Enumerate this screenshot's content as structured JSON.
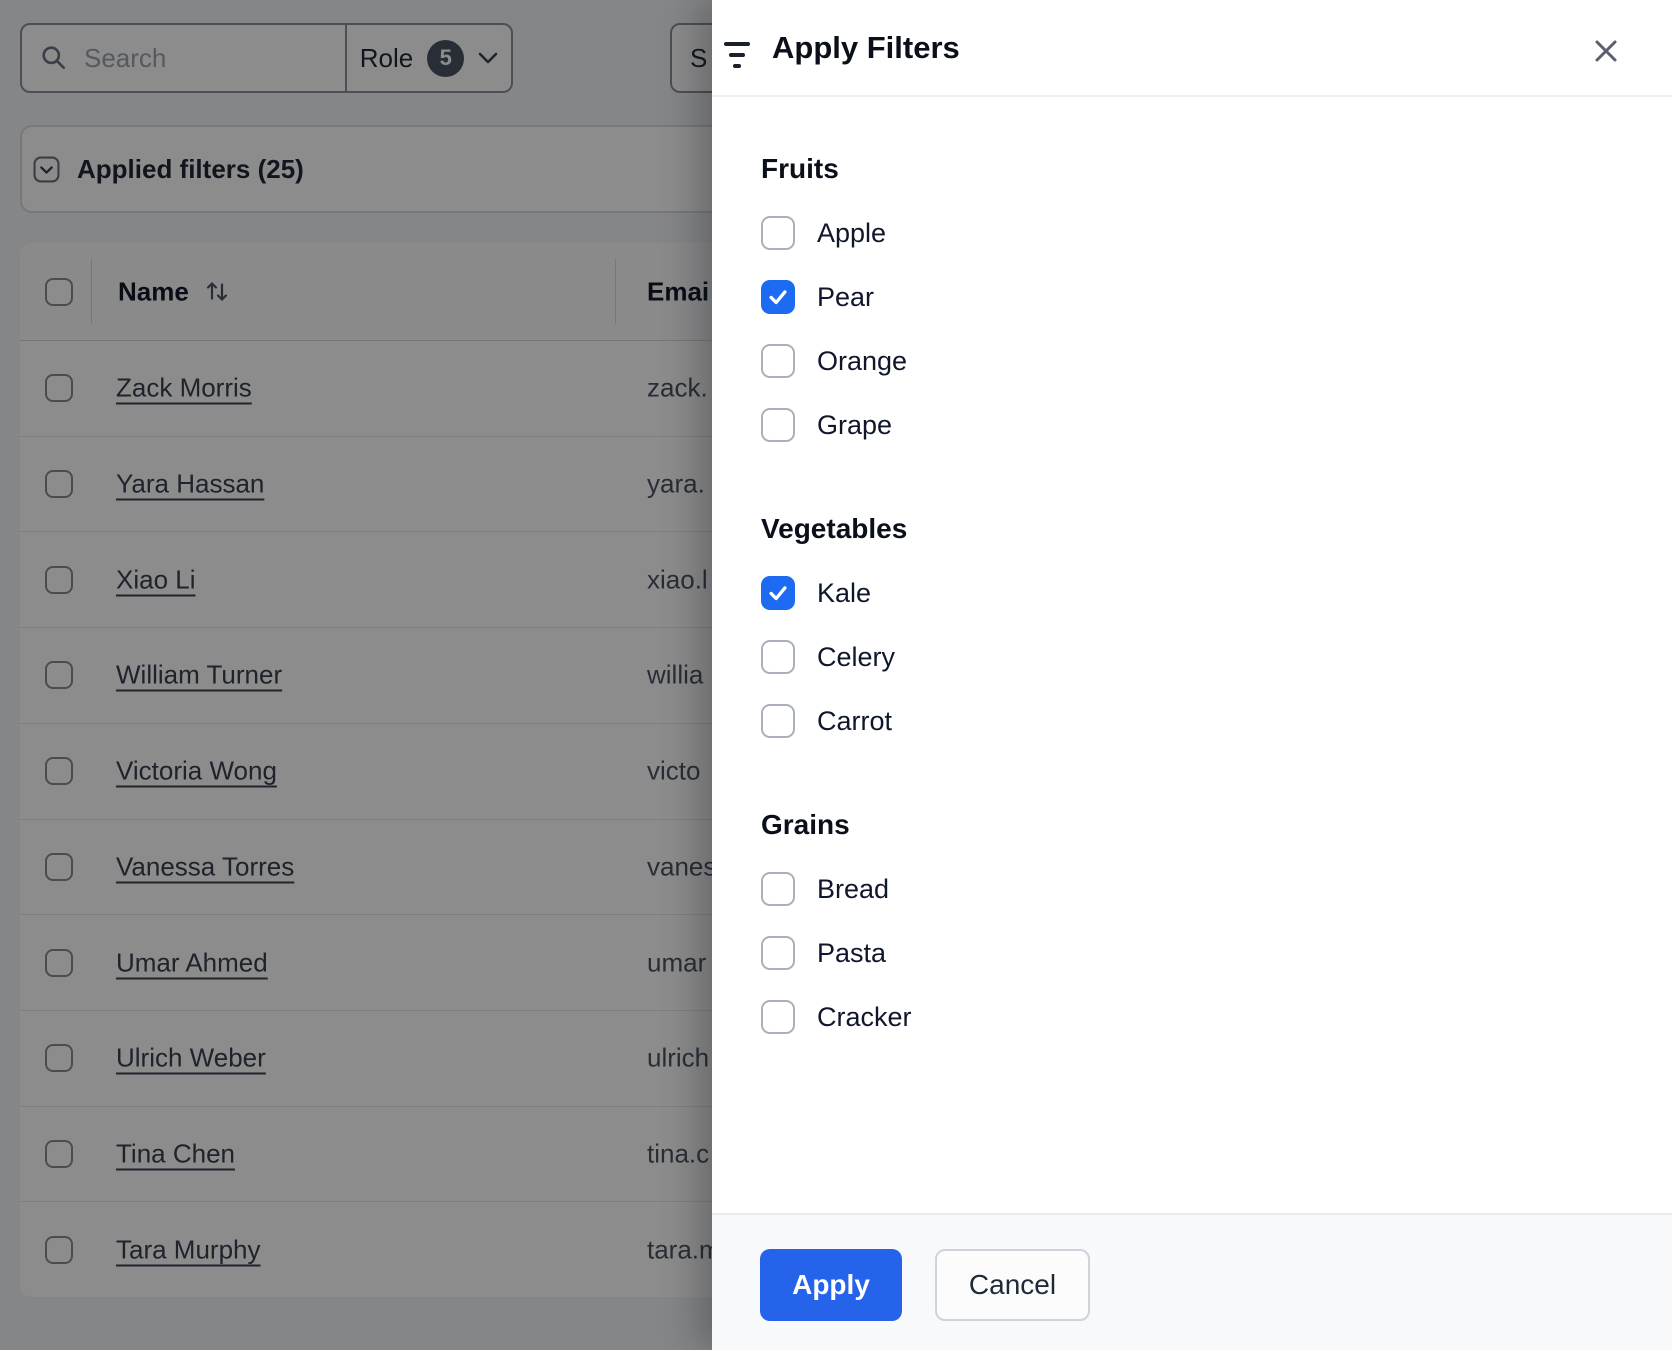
{
  "colors": {
    "accent_blue": "#2563eb",
    "checkbox_checked_blue": "#1d6bf3",
    "badge_gray": "#4b5563",
    "page_bg": "#f3f4f6",
    "panel_bg": "#ffffff",
    "footer_bg": "#f8f9fa",
    "scrim": "rgba(0,0,0,0.45)"
  },
  "toolbar": {
    "search_placeholder": "Search",
    "role_label": "Role",
    "role_count": "5",
    "status_partial_label": "S"
  },
  "applied_filters": {
    "label": "Applied filters (25)"
  },
  "table": {
    "header": {
      "name_label": "Name",
      "email_label": "Emai"
    },
    "rows": [
      {
        "name": "Zack Morris",
        "email": "zack."
      },
      {
        "name": "Yara Hassan",
        "email": "yara."
      },
      {
        "name": "Xiao Li",
        "email": "xiao.l"
      },
      {
        "name": "William Turner",
        "email": "willia"
      },
      {
        "name": "Victoria Wong",
        "email": "victo"
      },
      {
        "name": "Vanessa Torres",
        "email": "vanes"
      },
      {
        "name": "Umar Ahmed",
        "email": "umar"
      },
      {
        "name": "Ulrich Weber",
        "email": "ulrich"
      },
      {
        "name": "Tina Chen",
        "email": "tina.c"
      },
      {
        "name": "Tara Murphy",
        "email": "tara.m"
      }
    ]
  },
  "panel": {
    "title": "Apply Filters",
    "sections": [
      {
        "title": "Fruits",
        "options": [
          {
            "label": "Apple",
            "checked": false
          },
          {
            "label": "Pear",
            "checked": true
          },
          {
            "label": "Orange",
            "checked": false
          },
          {
            "label": "Grape",
            "checked": false
          }
        ]
      },
      {
        "title": "Vegetables",
        "options": [
          {
            "label": "Kale",
            "checked": true
          },
          {
            "label": "Celery",
            "checked": false
          },
          {
            "label": "Carrot",
            "checked": false
          }
        ]
      },
      {
        "title": "Grains",
        "options": [
          {
            "label": "Bread",
            "checked": false
          },
          {
            "label": "Pasta",
            "checked": false
          },
          {
            "label": "Cracker",
            "checked": false
          }
        ]
      }
    ],
    "apply_label": "Apply",
    "cancel_label": "Cancel"
  },
  "icons": [
    "search-icon",
    "chevron-down-icon",
    "applied-filters-chevron-icon",
    "sort-arrows-icon",
    "filter-icon",
    "close-icon",
    "checkmark-icon"
  ]
}
